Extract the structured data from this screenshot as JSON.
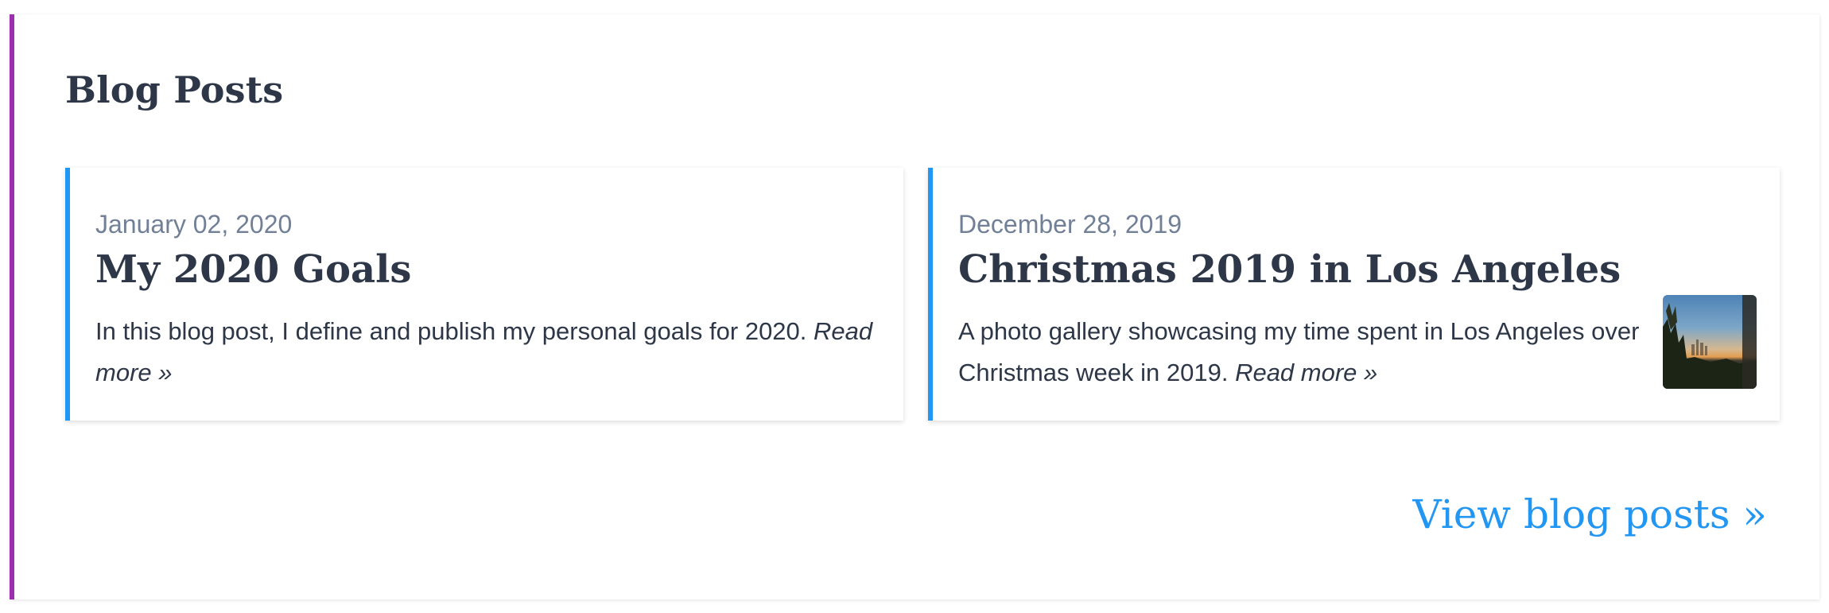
{
  "section": {
    "title": "Blog Posts",
    "accent_color": "#9b2fae"
  },
  "posts": [
    {
      "date": "January 02, 2020",
      "title": "My 2020 Goals",
      "summary": "In this blog post, I define and publish my personal goals for 2020.",
      "read_more": "Read more »",
      "accent_color": "#2196f3"
    },
    {
      "date": "December 28, 2019",
      "title": "Christmas 2019 in Los Angeles",
      "summary": "A photo gallery showcasing my time spent in Los Angeles over Christmas week in 2019.",
      "read_more": "Read more »",
      "accent_color": "#2196f3",
      "thumbnail": "los-angeles-sunset-photo"
    }
  ],
  "footer": {
    "view_all_label": "View blog posts »"
  }
}
